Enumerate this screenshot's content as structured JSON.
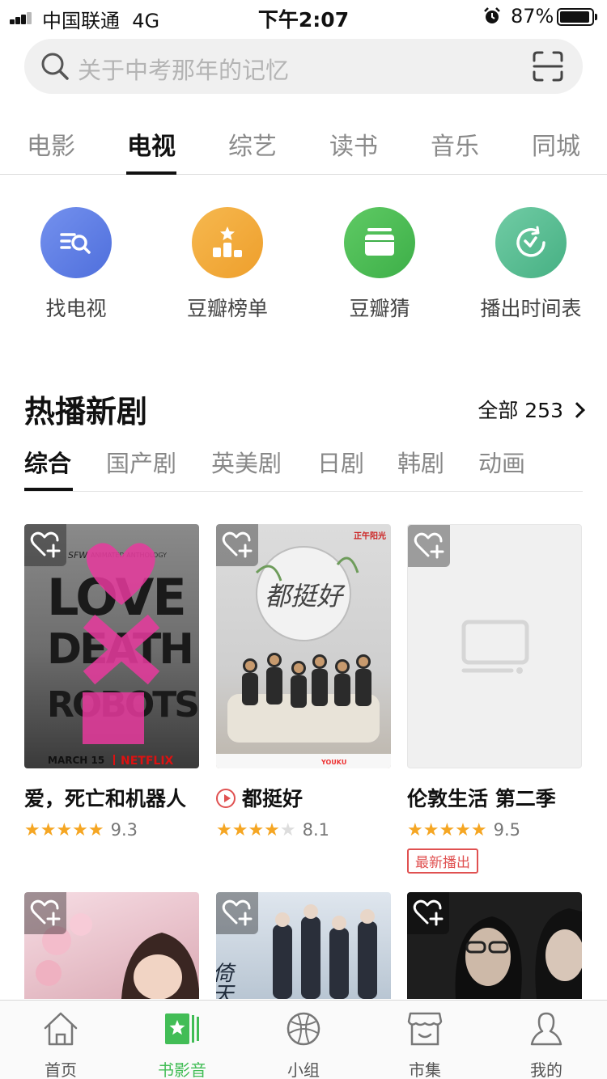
{
  "status_bar": {
    "carrier": "中国联通",
    "network": "4G",
    "time": "下午2:07",
    "battery": "87%",
    "signal_bars_active": 3,
    "signal_bars_total": 5,
    "battery_level": 0.87,
    "icons": [
      "signal-icon",
      "alarm-icon",
      "battery-icon"
    ]
  },
  "search": {
    "placeholder": "关于中考那年的记忆",
    "icons": [
      "search-icon",
      "scan-icon"
    ]
  },
  "top_tabs": {
    "items": [
      "电影",
      "电视",
      "综艺",
      "读书",
      "音乐",
      "同城"
    ],
    "active": "电视"
  },
  "quick_entries": [
    {
      "label": "找电视",
      "icon": "find-tv-icon",
      "color": "#5b7de6"
    },
    {
      "label": "豆瓣榜单",
      "icon": "ranking-icon",
      "color": "#f2a93b"
    },
    {
      "label": "豆瓣猜",
      "icon": "guess-icon",
      "color": "#4cbf56"
    },
    {
      "label": "播出时间表",
      "icon": "schedule-icon",
      "color": "#5cc095"
    }
  ],
  "section": {
    "title": "热播新剧",
    "all_label": "全部 253",
    "sub_tabs": [
      "综合",
      "国产剧",
      "英美剧",
      "日剧",
      "韩剧",
      "动画"
    ],
    "active_sub_tab": "综合"
  },
  "cards": [
    {
      "title": "爱，死亡和机器人",
      "stars": 5,
      "rating": "9.3",
      "poster_text": {
        "tagline": "SFW",
        "subtitle": "ANIMATED ANTHOLOGY",
        "line1": "LOVE",
        "line2": "DEATH",
        "line3": "ROBOTS",
        "date": "MARCH 15",
        "brand": "NETFLIX"
      }
    },
    {
      "title": "都挺好",
      "stars": 4,
      "rating": "8.1",
      "playable": true,
      "poster_text": {
        "calligraphy": "都挺好",
        "corner": "正午阳光",
        "sponsor": "YOUKU"
      }
    },
    {
      "title": "伦敦生活 第二季",
      "stars": 5,
      "rating": "9.5",
      "badge": "最新播出",
      "placeholder_icon": "tv-icon"
    }
  ],
  "row2_posters": [
    {
      "name": "poster-cherry-blossom"
    },
    {
      "name": "poster-wuxia",
      "calligraphy": "倚天屠龙记"
    },
    {
      "name": "poster-dark-drama"
    }
  ],
  "bottom_nav": {
    "items": [
      {
        "label": "首页",
        "icon": "home-icon"
      },
      {
        "label": "书影音",
        "icon": "book-movie-music-icon"
      },
      {
        "label": "小组",
        "icon": "group-icon"
      },
      {
        "label": "市集",
        "icon": "market-icon"
      },
      {
        "label": "我的",
        "icon": "profile-icon"
      }
    ],
    "active": "书影音",
    "active_color": "#42bd56"
  }
}
